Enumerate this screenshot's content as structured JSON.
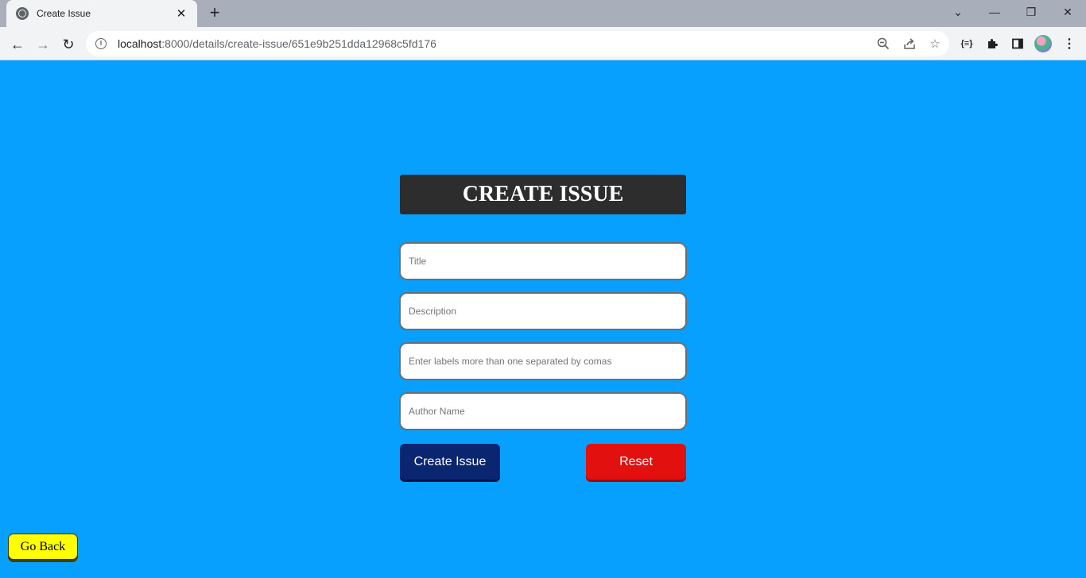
{
  "browser": {
    "tab_title": "Create Issue",
    "tab_close": "✕",
    "new_tab": "+",
    "url_host": "localhost",
    "url_path": ":8000/details/create-issue/651e9b251dda12968c5fd176",
    "icons": [
      "back-icon",
      "forward-icon",
      "reload-icon",
      "info-icon",
      "zoom-icon",
      "share-icon",
      "star-icon",
      "json-ext-icon",
      "puzzle-icon",
      "sidepanel-icon",
      "avatar",
      "menu-icon"
    ]
  },
  "form": {
    "heading": "CREATE ISSUE",
    "title_placeholder": "Title",
    "description_placeholder": "Description",
    "labels_placeholder": "Enter labels more than one separated by comas",
    "author_placeholder": "Author Name",
    "create_label": "Create Issue",
    "reset_label": "Reset"
  },
  "go_back_label": "Go Back",
  "colors": {
    "page_bg": "#08a0ff",
    "heading_bg": "#2d2d2d",
    "create_btn": "#0a2670",
    "reset_btn": "#e31010",
    "go_back_btn": "#ffff00"
  }
}
